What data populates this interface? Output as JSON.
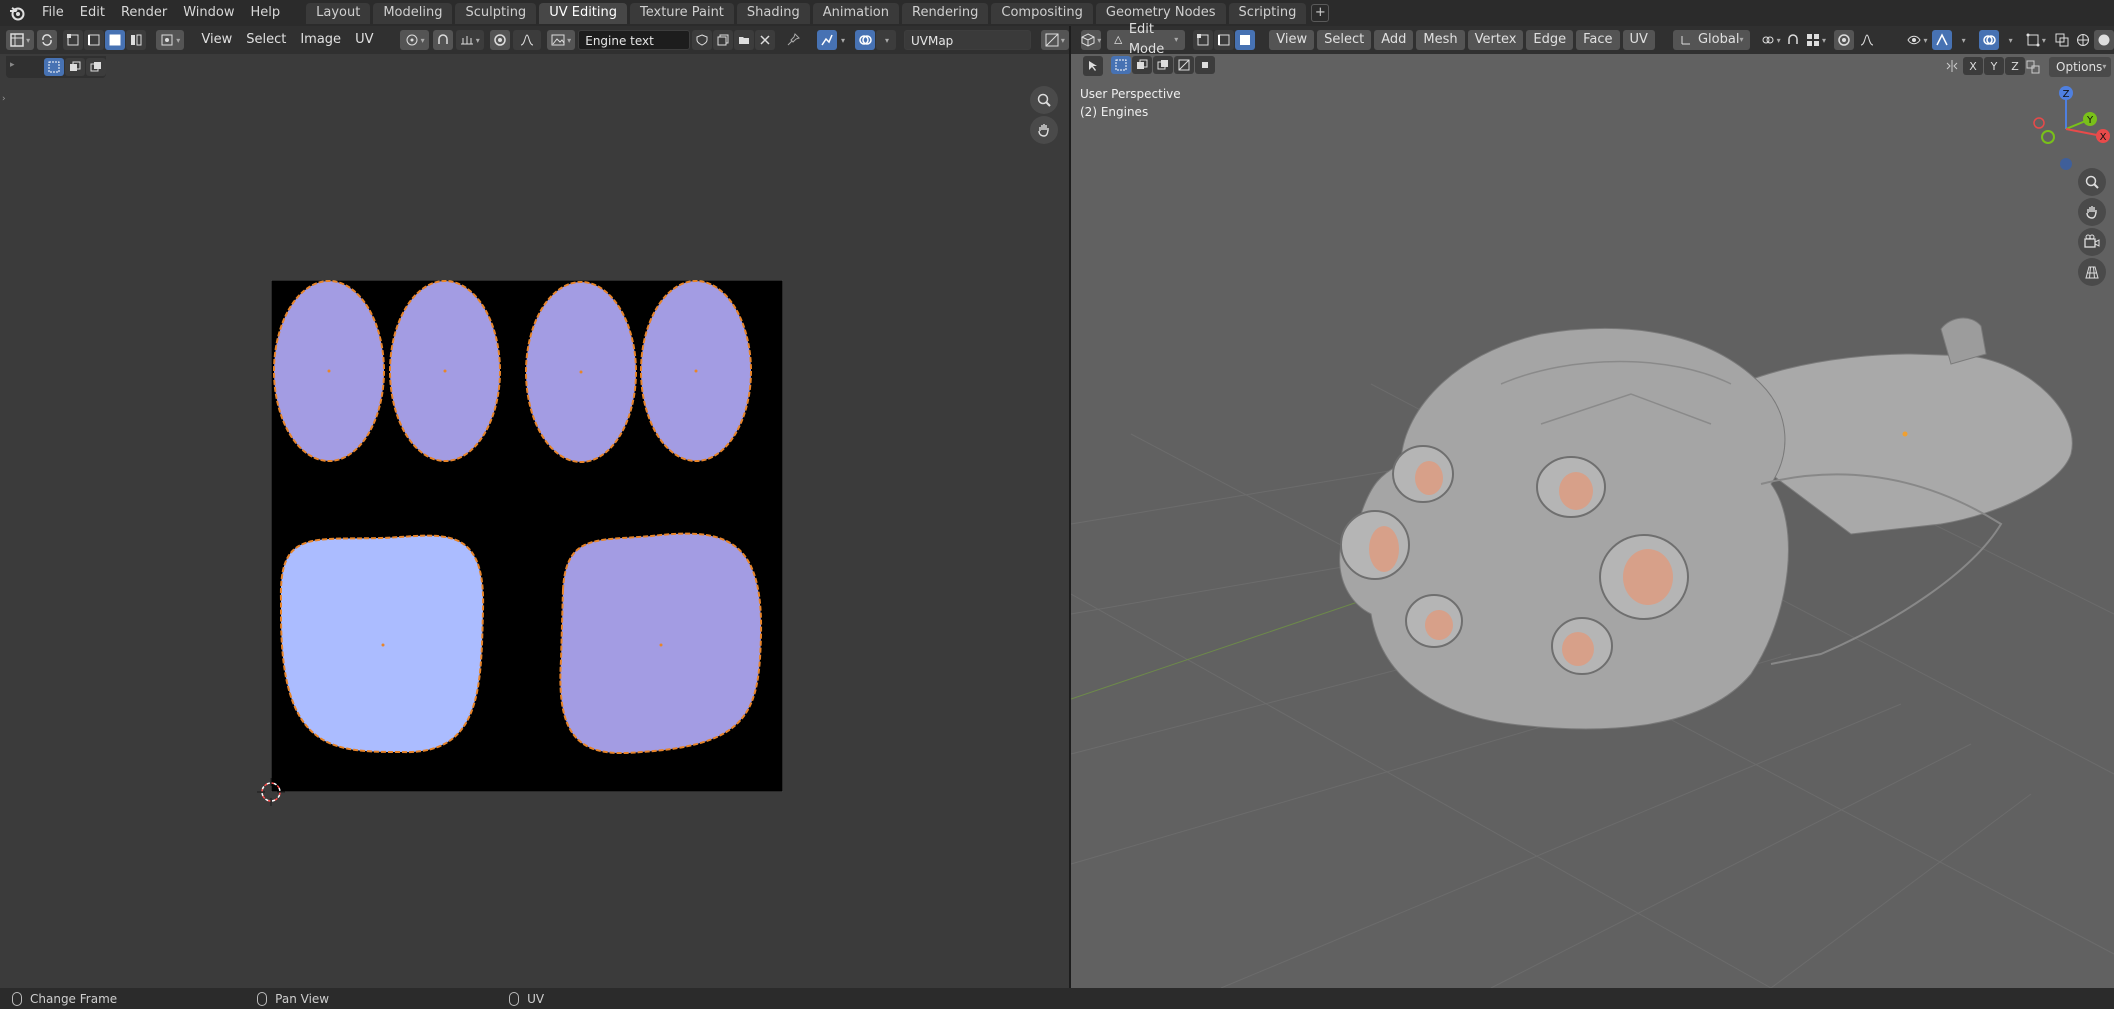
{
  "menu": {
    "items": [
      "File",
      "Edit",
      "Render",
      "Window",
      "Help"
    ]
  },
  "workspaces": {
    "tabs": [
      "Layout",
      "Modeling",
      "Sculpting",
      "UV Editing",
      "Texture Paint",
      "Shading",
      "Animation",
      "Rendering",
      "Compositing",
      "Geometry Nodes",
      "Scripting"
    ],
    "active": "UV Editing",
    "add_label": "+"
  },
  "uv_editor": {
    "menus": [
      "View",
      "Select",
      "Image",
      "UV"
    ],
    "image_name": "Engine text",
    "uv_map": "UVMap"
  },
  "viewport": {
    "mode": "Edit Mode",
    "menus": [
      "View",
      "Select",
      "Add",
      "Mesh",
      "Vertex",
      "Edge",
      "Face",
      "UV"
    ],
    "orientation": "Global",
    "perspective_label": "User Perspective",
    "object_label": "(2) Engines",
    "options_label": "Options",
    "axis_buttons": [
      "X",
      "Y",
      "Z"
    ],
    "gizmo": {
      "z": "Z",
      "y": "Y",
      "x": "X"
    }
  },
  "status_bar": {
    "left": "Change Frame",
    "middle": "Pan View",
    "right": "UV"
  },
  "colors": {
    "uv_island": "#a39ce3",
    "uv_island_selected": "#abbcff",
    "uv_edge": "#e8852a",
    "active_tab": "#474747",
    "accent": "#4772b3",
    "engine_glow": "#d7a089"
  }
}
